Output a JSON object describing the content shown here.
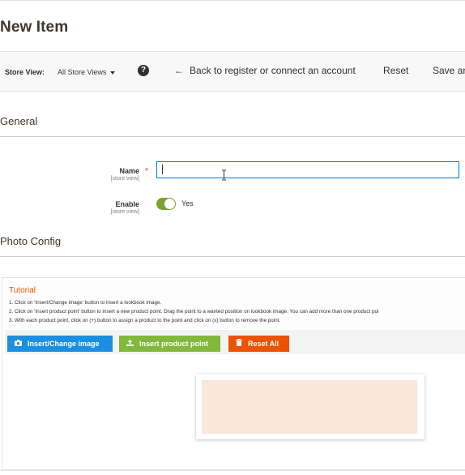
{
  "page": {
    "title": "New Item"
  },
  "store_bar": {
    "label": "Store View:",
    "value": "All Store Views",
    "help_icon": "question-circle-icon",
    "back_label": "Back to register or connect an account",
    "back_icon": "arrow-left-icon",
    "reset_label": "Reset",
    "save_label": "Save an"
  },
  "general": {
    "title": "General",
    "name_label": "Name",
    "name_scope": "[store view]",
    "name_value": "",
    "enable_label": "Enable",
    "enable_scope": "[store view]",
    "enable_state": "Yes",
    "toggle_color": "#79a22e"
  },
  "photo_config": {
    "title": "Photo Config",
    "tutorial_title": "Tutorial",
    "tutorial_lines": [
      "1. Click on 'Insert/Change image' button to insert a lookbook image.",
      "2. Click on 'Insert product point' button to insert a new product point. Drag the point to a wanted position on lookbook image. You can add more than one product poi",
      "3. With each product point, click on (+) button to assign a product to the point and click on (x) button to remove the point."
    ],
    "buttons": {
      "insert_image": "Insert/Change image",
      "insert_point": "Insert product point",
      "reset_all": "Reset All"
    },
    "button_colors": {
      "insert_image": "#1d8fe0",
      "insert_point": "#82b83c",
      "reset_all": "#eb5202"
    },
    "accent": "#eb5202"
  }
}
